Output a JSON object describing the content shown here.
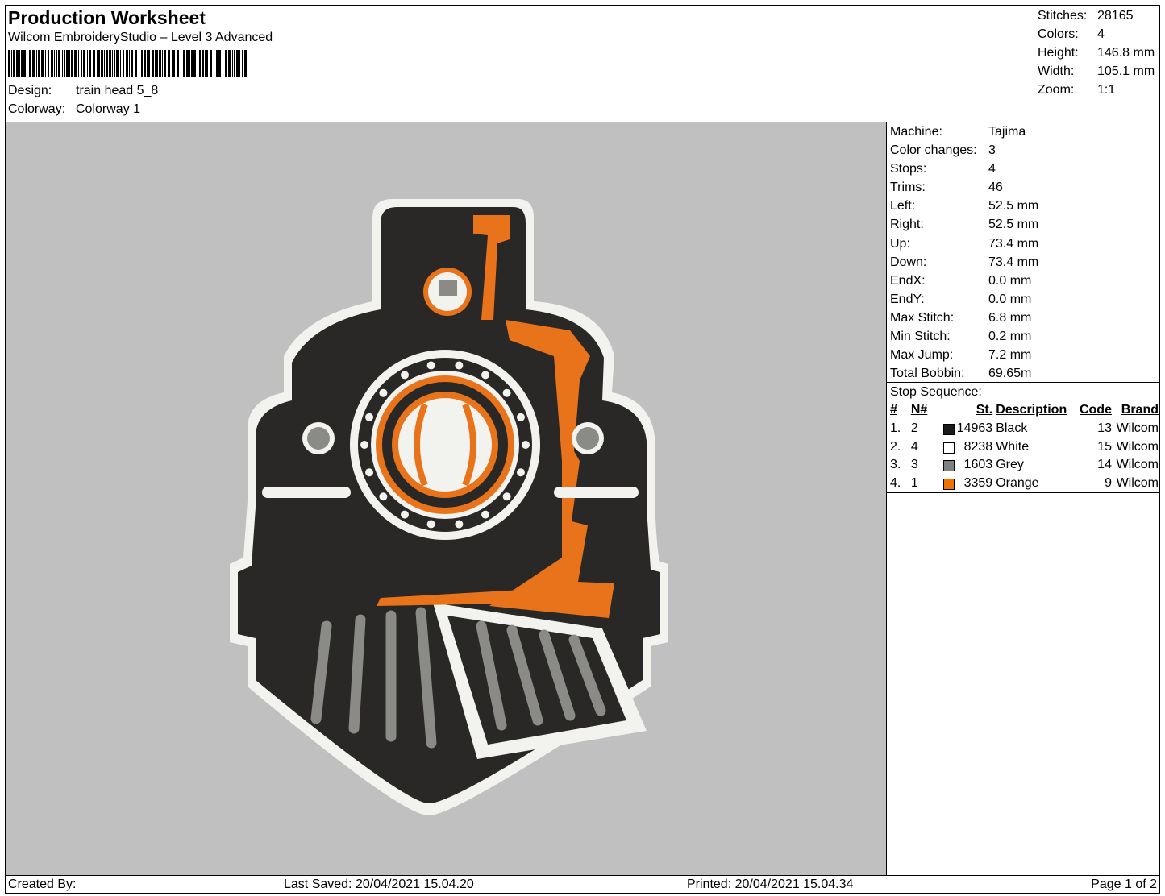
{
  "header": {
    "title": "Production Worksheet",
    "subtitle": "Wilcom EmbroideryStudio – Level 3 Advanced",
    "design_label": "Design:",
    "design_value": "train head 5_8",
    "colorway_label": "Colorway:",
    "colorway_value": "Colorway 1"
  },
  "summary": [
    {
      "label": "Stitches:",
      "value": "28165"
    },
    {
      "label": "Colors:",
      "value": "4"
    },
    {
      "label": "Height:",
      "value": "146.8 mm"
    },
    {
      "label": "Width:",
      "value": "105.1 mm"
    },
    {
      "label": "Zoom:",
      "value": "1:1"
    }
  ],
  "details": [
    {
      "label": "Machine:",
      "value": "Tajima"
    },
    {
      "label": "Color changes:",
      "value": "3"
    },
    {
      "label": "Stops:",
      "value": "4"
    },
    {
      "label": "Trims:",
      "value": "46"
    },
    {
      "label": "Left:",
      "value": "52.5 mm"
    },
    {
      "label": "Right:",
      "value": "52.5 mm"
    },
    {
      "label": "Up:",
      "value": "73.4 mm"
    },
    {
      "label": "Down:",
      "value": "73.4 mm"
    },
    {
      "label": "EndX:",
      "value": "0.0 mm"
    },
    {
      "label": "EndY:",
      "value": "0.0 mm"
    },
    {
      "label": "Max Stitch:",
      "value": "6.8 mm"
    },
    {
      "label": "Min Stitch:",
      "value": "0.2 mm"
    },
    {
      "label": "Max Jump:",
      "value": "7.2 mm"
    },
    {
      "label": "Total Bobbin:",
      "value": "69.65m"
    }
  ],
  "stop_sequence": {
    "title": "Stop Sequence:",
    "headers": [
      "#",
      "N#",
      "St.",
      "Description",
      "Code",
      "Brand"
    ],
    "rows": [
      {
        "idx": "1.",
        "n": "2",
        "color": "#1a1a1a",
        "stitches": "14963",
        "desc": "Black",
        "code": "13",
        "brand": "Wilcom"
      },
      {
        "idx": "2.",
        "n": "4",
        "color": "#ffffff",
        "stitches": "8238",
        "desc": "White",
        "code": "15",
        "brand": "Wilcom"
      },
      {
        "idx": "3.",
        "n": "3",
        "color": "#808080",
        "stitches": "1603",
        "desc": "Grey",
        "code": "14",
        "brand": "Wilcom"
      },
      {
        "idx": "4.",
        "n": "1",
        "color": "#f07000",
        "stitches": "3359",
        "desc": "Orange",
        "code": "9",
        "brand": "Wilcom"
      }
    ]
  },
  "footer": {
    "created": "Created By:",
    "saved": "Last Saved: 20/04/2021 15.04.20",
    "printed": "Printed: 20/04/2021 15.04.34",
    "page": "Page 1 of 2"
  },
  "colors": {
    "preview_bg": "#c0c0c0",
    "black": "#2a2826",
    "orange": "#e8731a",
    "white": "#f2f2ee",
    "grey": "#8a8a86"
  }
}
